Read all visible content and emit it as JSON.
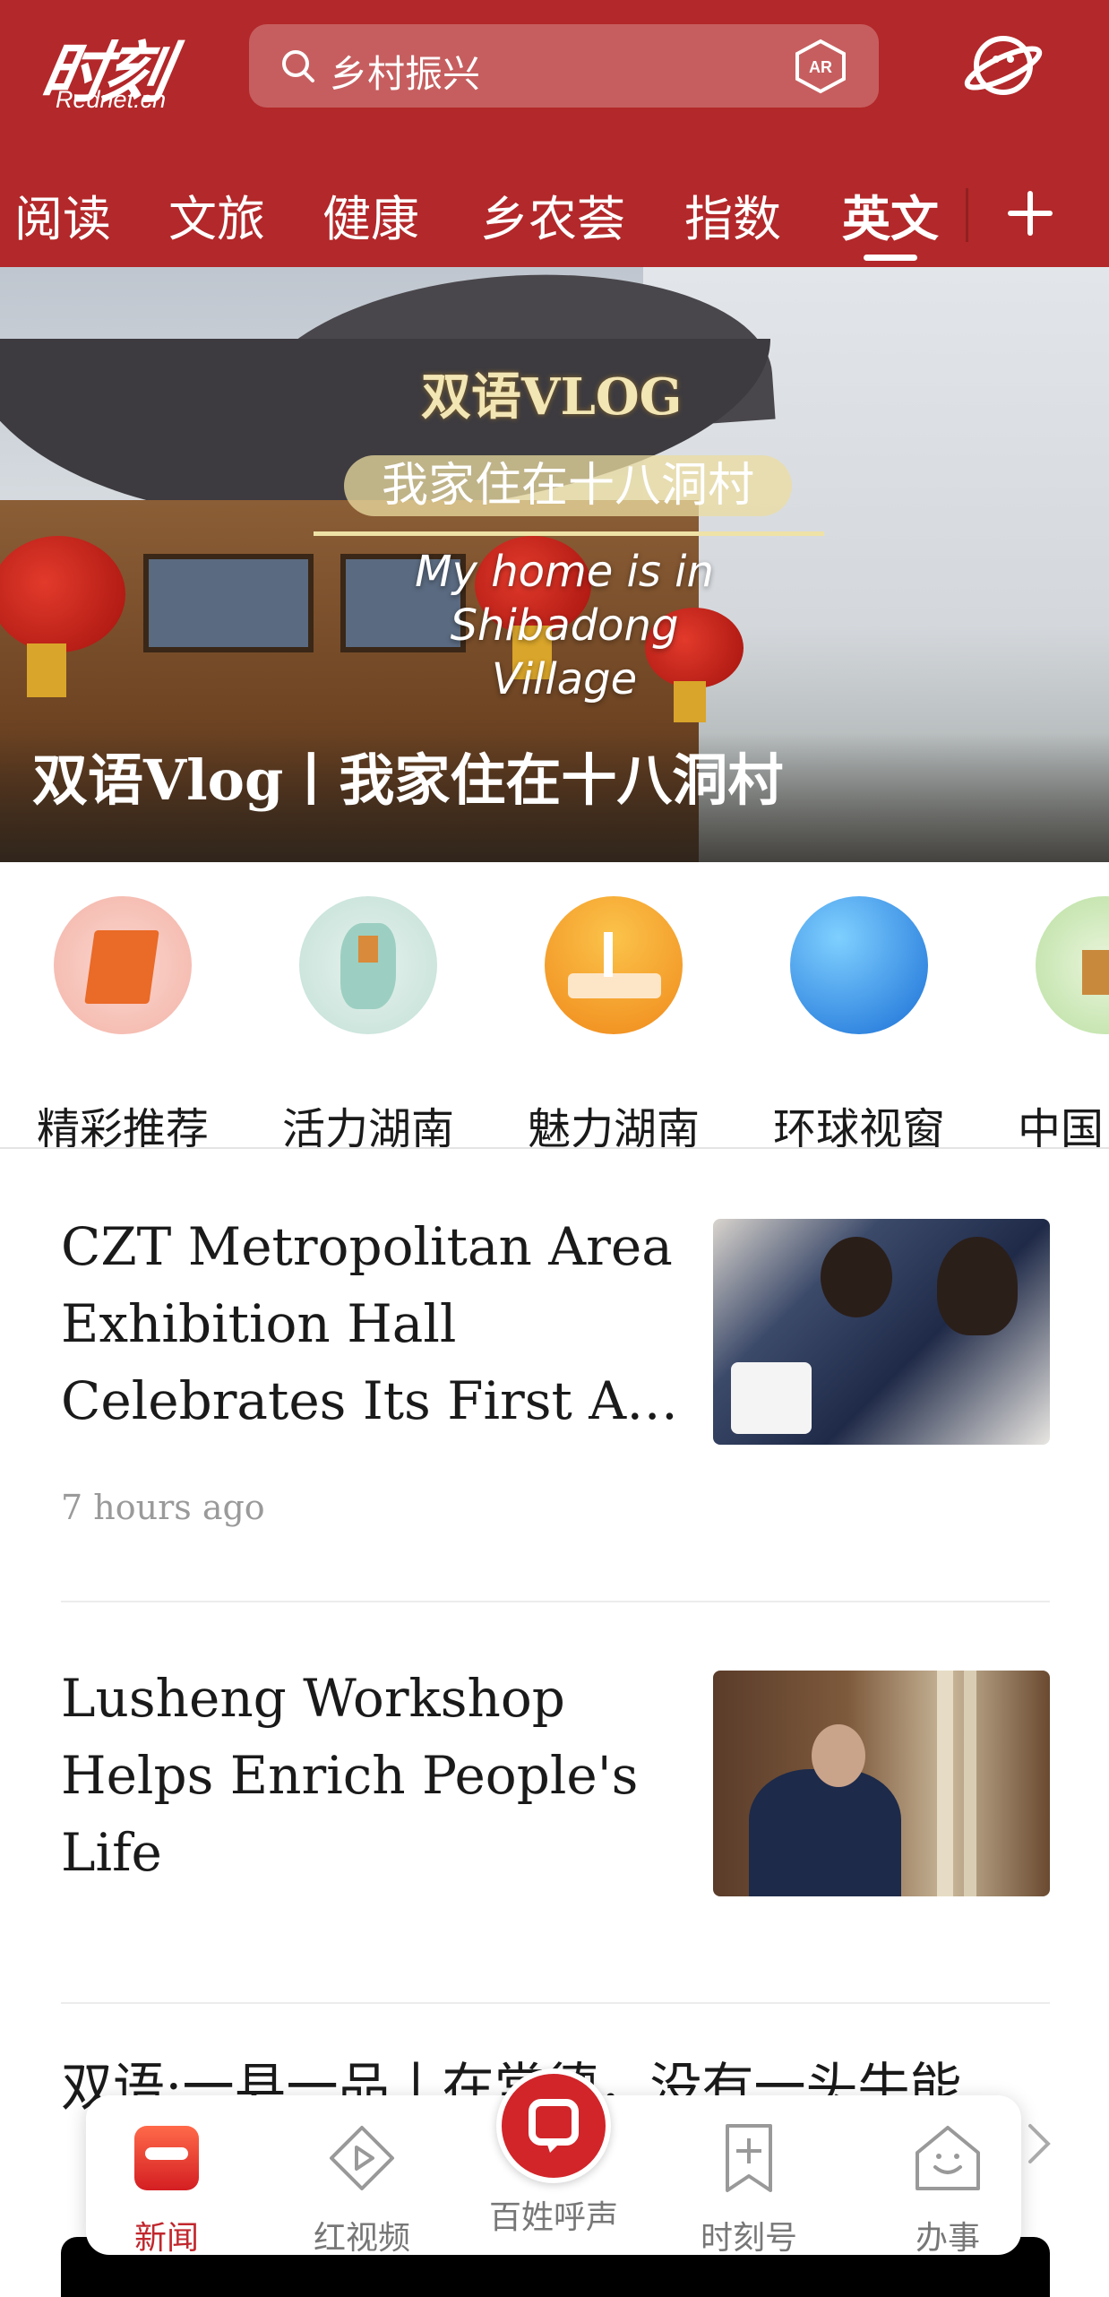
{
  "header": {
    "logo_cn": "时刻",
    "logo_en": "Rednet.cn",
    "search_text": "乡村振兴",
    "ar_label": "AR",
    "tabs": [
      "阅读",
      "文旅",
      "健康",
      "乡农荟",
      "指数",
      "英文"
    ],
    "active_tab": "英文"
  },
  "banner": {
    "vlog_title": "双语VLOG",
    "vlog_subtitle": "我家住在十八洞村",
    "vlog_english": "My home is in Shibadong Village",
    "caption": "双语Vlog丨我家住在十八洞村"
  },
  "categories": [
    {
      "label": "精彩推荐"
    },
    {
      "label": "活力湖南"
    },
    {
      "label": "魅力湖南"
    },
    {
      "label": "环球视窗"
    },
    {
      "label": "中国"
    }
  ],
  "news": [
    {
      "title": "CZT Metropolitan Area Exhibition Hall Celebrates Its First A…",
      "time": "7 hours ago"
    },
    {
      "title": "Lusheng Workshop Helps Enrich People's Life",
      "time": ""
    },
    {
      "title": "双语:一县一品丨在常德，没有一头牛能",
      "time": ""
    }
  ],
  "bottom_nav": {
    "items": [
      "新闻",
      "红视频",
      "百姓呼声",
      "时刻号",
      "办事"
    ],
    "active": "新闻"
  },
  "colors": {
    "brand_red": "#b3282a",
    "active_nav": "#c1272d"
  }
}
